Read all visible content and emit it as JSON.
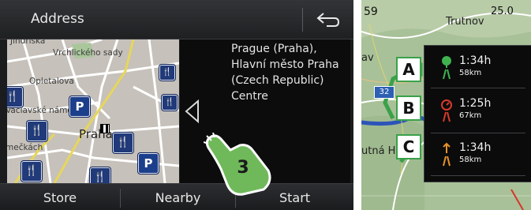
{
  "header": {
    "title": "Address"
  },
  "map": {
    "labels": [
      "Jindřiška",
      "Vrchlického sady",
      "Opletalova",
      "Václavské náměstí",
      "mečkách",
      "Praha"
    ],
    "poi_parking": "P"
  },
  "destination": {
    "address_lines": [
      "Prague (Praha),",
      "Hlavní město Praha",
      "(Czech Republic)",
      "Centre"
    ]
  },
  "bottom_bar": {
    "store": "Store",
    "nearby": "Nearby",
    "start": "Start"
  },
  "step_marker": "3",
  "right_map": {
    "top_left": "59",
    "top_right": "25.0",
    "city": "Trutnov",
    "label_left": "av",
    "label_bottom": "utná H",
    "road_number": "32"
  },
  "routes": [
    {
      "marker": "A",
      "time": "1:34h",
      "distance": "58km",
      "icon": "eco-tree-icon",
      "color": "#3fb34f"
    },
    {
      "marker": "B",
      "time": "1:25h",
      "distance": "67km",
      "icon": "stopwatch-icon",
      "color": "#d93a2b"
    },
    {
      "marker": "C",
      "time": "1:34h",
      "distance": "58km",
      "icon": "road-balance-icon",
      "color": "#e6922a"
    }
  ],
  "colors": {
    "accent_green": "#3aa14a",
    "poi_blue": "#1c3f8c"
  }
}
